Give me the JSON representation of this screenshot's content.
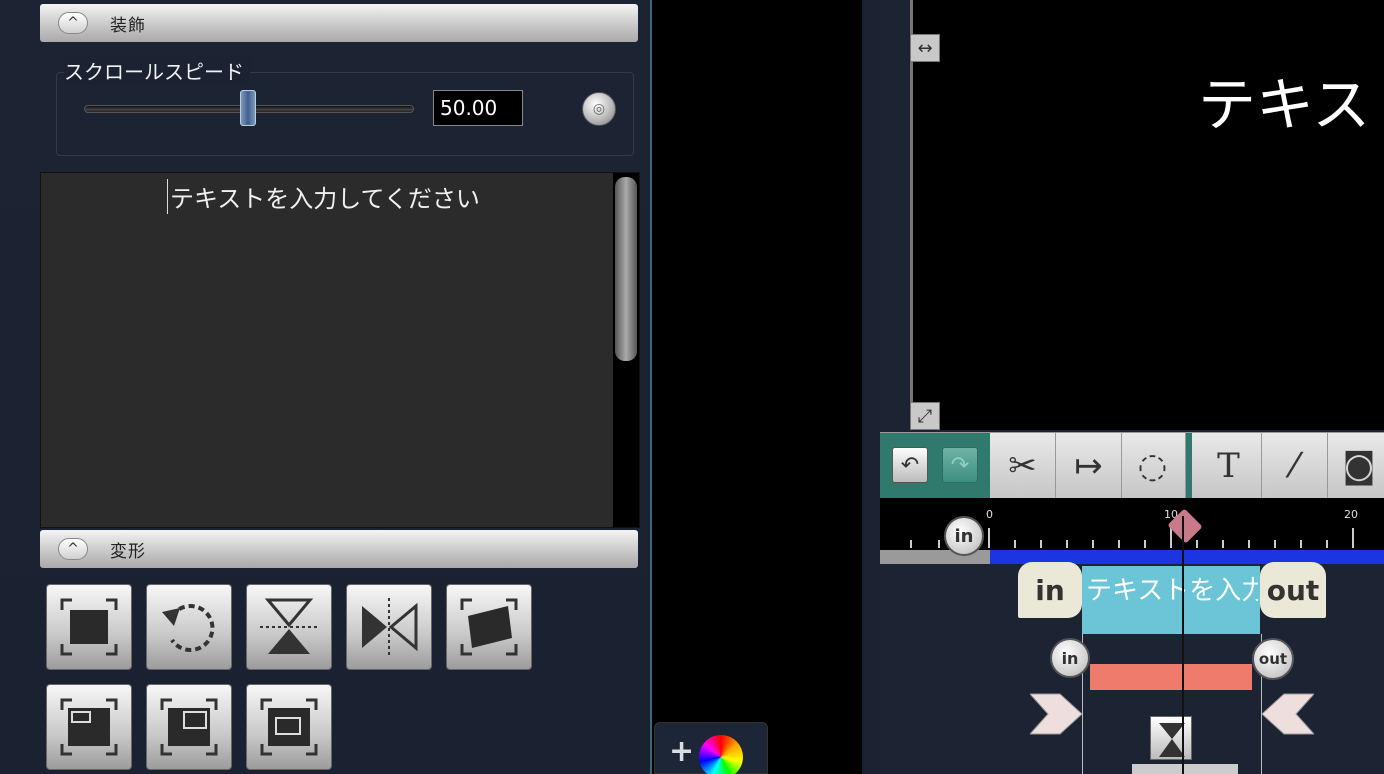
{
  "left_panel": {
    "section_top": {
      "label": "装飾",
      "collapse": "^"
    },
    "scroll_speed": {
      "label": "スクロールスピード",
      "value": "50.00"
    },
    "text_content": "テキストを入力してください",
    "section_transform": {
      "label": "変形",
      "collapse": "^"
    },
    "transform_buttons": [
      "fit-screen-icon",
      "rotate-icon",
      "flip-vertical-icon",
      "flip-horizontal-icon",
      "tilt-icon",
      "picture-top-left-icon",
      "picture-top-right-icon",
      "picture-center-icon"
    ]
  },
  "color_tab": {
    "plus": "+"
  },
  "preview": {
    "text": "テキス",
    "handle_top": "↔",
    "handle_bottom": "⤢"
  },
  "toolbar": {
    "undo": "↶",
    "redo": "↷",
    "cut": "✂",
    "split": "↦",
    "lasso": "◌",
    "text": "T",
    "brush": "⁄",
    "snapshot": "◙"
  },
  "timeline": {
    "ticks": [
      "0",
      "10",
      "20"
    ],
    "in_label": "in",
    "clip_label": "テキストを入力",
    "clip_in": "in",
    "clip_out": "out",
    "key_in": "in",
    "key_out": "out"
  },
  "colors": {
    "panel_bg": "#1c2434",
    "toolbar_accent": "#2f7a6d",
    "track_blue": "#1b35e0",
    "clip_teal": "#6bc5d6",
    "keyframe_salmon": "#ef7b6c"
  }
}
